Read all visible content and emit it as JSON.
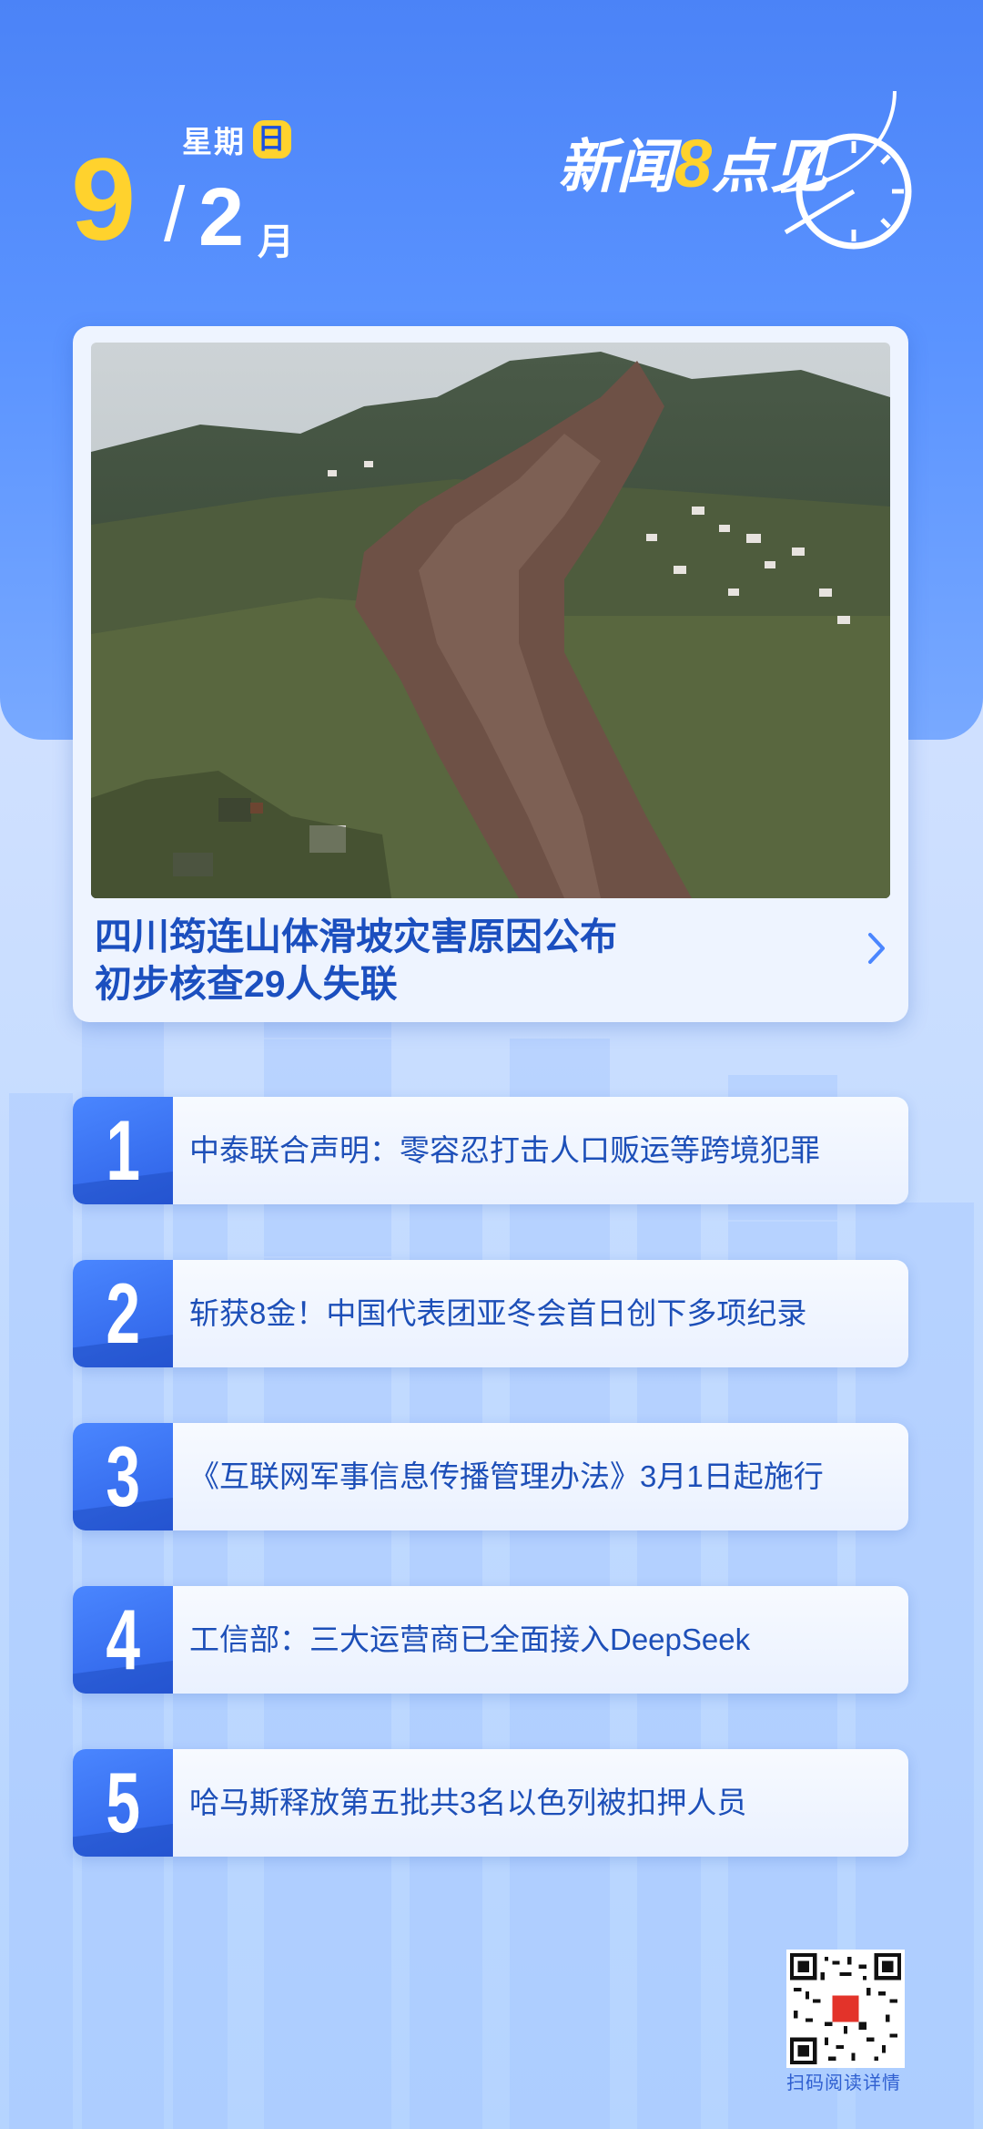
{
  "date": {
    "weekday_prefix": "星期",
    "weekday_badge": "日",
    "day": "9",
    "slash": "/",
    "month": "2",
    "month_unit": "月"
  },
  "brand": {
    "logo_text_1": "新闻",
    "logo_text_2": "8",
    "logo_text_3": "点见"
  },
  "hero": {
    "title_line1": "四川筠连山体滑坡灾害原因公布",
    "title_line2": "初步核查29人失联"
  },
  "news": [
    {
      "num": "1",
      "text": "中泰联合声明：零容忍打击人口贩运等跨境犯罪"
    },
    {
      "num": "2",
      "text": "斩获8金！中国代表团亚冬会首日创下多项纪录"
    },
    {
      "num": "3",
      "text": "《互联网军事信息传播管理办法》3月1日起施行"
    },
    {
      "num": "4",
      "text": "工信部：三大运营商已全面接入DeepSeek"
    },
    {
      "num": "5",
      "text": "哈马斯释放第五批共3名以色列被扣押人员"
    }
  ],
  "footer": {
    "qr_label": "扫码阅读详情"
  },
  "colors": {
    "accent_yellow": "#ffd22d",
    "primary_blue": "#2d61e6",
    "text_blue": "#1d4fb8"
  }
}
